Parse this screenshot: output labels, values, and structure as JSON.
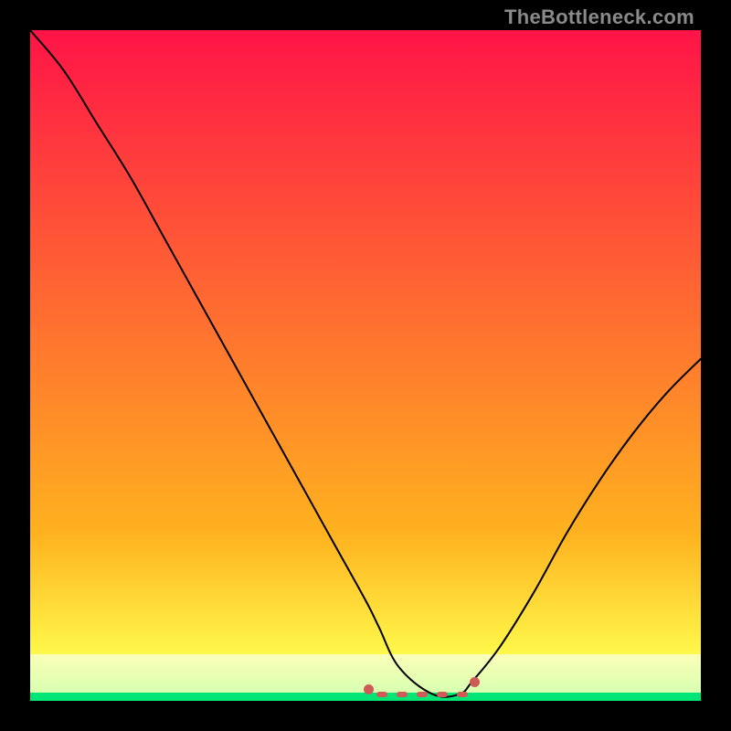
{
  "watermark": "TheBottleneck.com",
  "chart_data": {
    "type": "line",
    "title": "",
    "xlabel": "",
    "ylabel": "",
    "xlim": [
      0,
      100
    ],
    "ylim": [
      0,
      100
    ],
    "grid": false,
    "legend": false,
    "series": [
      {
        "name": "bottleneck-curve",
        "x": [
          0,
          5,
          10,
          15,
          20,
          25,
          30,
          35,
          40,
          45,
          50,
          52,
          55,
          60,
          64,
          66,
          70,
          75,
          80,
          85,
          90,
          95,
          100
        ],
        "values": [
          100,
          94,
          86,
          78,
          69,
          60,
          51,
          42,
          33,
          24,
          15,
          11,
          5,
          1,
          1,
          3,
          8,
          16,
          25,
          33,
          40,
          46,
          51
        ]
      }
    ],
    "flat_minimum_segment": {
      "x_start": 51,
      "x_end": 66
    },
    "bottleneck_zone_center_x": 58,
    "background_bands": [
      {
        "name": "bad-top",
        "y_start": 100,
        "y_end": 25,
        "color_top": "#ff1447",
        "color_bottom": "#ffb21f"
      },
      {
        "name": "ok-mid",
        "y_start": 25,
        "y_end": 7,
        "color_top": "#ffb21f",
        "color_bottom": "#fff84a"
      },
      {
        "name": "good-low",
        "y_start": 7,
        "y_end": 1.2,
        "color_top": "#fbffb8",
        "color_bottom": "#d8ffb0"
      },
      {
        "name": "sweet-bottom",
        "y_start": 1.2,
        "y_end": 0,
        "color_top": "#00e676",
        "color_bottom": "#00e676"
      }
    ]
  }
}
